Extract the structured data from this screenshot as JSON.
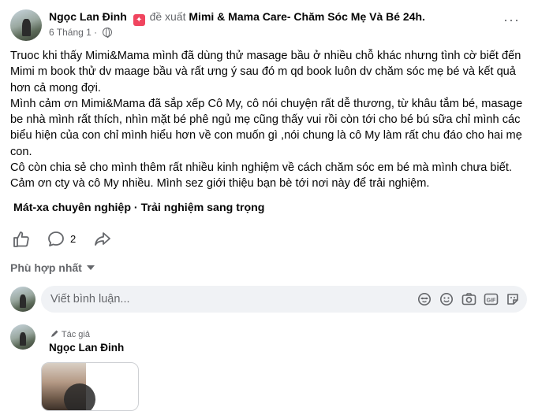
{
  "post": {
    "author": "Ngọc Lan Đinh",
    "verb": "đề xuất",
    "page": "Mimi & Mama Care- Chăm Sóc Mẹ Và Bé 24h.",
    "date": "6 Tháng 1 ·",
    "more_icon": "more-horizontal-icon",
    "body": [
      "Truoc khi thấy Mimi&Mama mình đã dùng thử masage bầu ở nhiều chỗ khác nhưng tình cờ biết đến Mimi m book thử dv maage bầu và rất ưng ý sau đó m qd book luôn dv chăm sóc mẹ bé và kết quả hơn cả mong đợi.",
      "Mình cảm ơn Mimi&Mama đã sắp xếp Cô My, cô nói chuyện rất dễ thương, từ khâu tắm bé, masage be nhà mình rất thích, nhìn mặt bé phê ngủ mẹ cũng thấy vui rồi còn tới cho bé bú sữa chỉ mình các biểu hiện của con chỉ mình hiểu hơn về con muốn gì ,nói chung là cô My làm rất  chu đáo cho hai mẹ con.",
      "Cô còn chia sẻ cho mình thêm rất nhiều kinh nghiệm về cách chăm sóc em bé mà mình chưa biết. Cảm ơn cty và cô My nhiều. Mình sez giới thiệu bạn bè tới nơi này để trải nghiệm."
    ],
    "caption": "Mát-xa chuyên nghiệp · Trải nghiệm sang trọng",
    "comment_count": "2"
  },
  "sort": {
    "label": "Phù hợp nhất"
  },
  "composer": {
    "placeholder": "Viết bình luận...",
    "tools": [
      "avatar-sticker-icon",
      "emoji-icon",
      "camera-icon",
      "gif-icon",
      "sticker-icon"
    ]
  },
  "reply": {
    "author_tag": "Tác giả",
    "author": "Ngọc Lan Đinh"
  },
  "colors": {
    "text_primary": "#050505",
    "text_secondary": "#65676b",
    "composer_bg": "#f0f2f5",
    "badge": "#f0455f"
  }
}
